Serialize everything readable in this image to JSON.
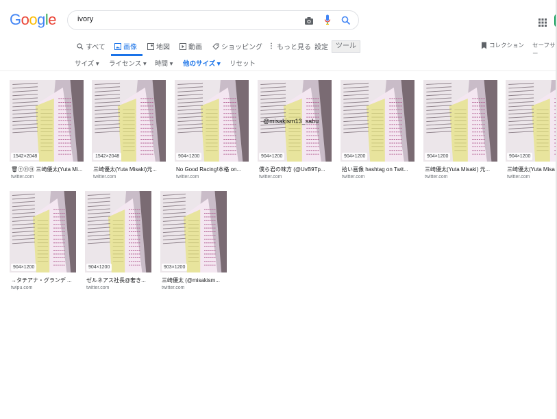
{
  "logo": {
    "g1": "G",
    "o1": "o",
    "o2": "o",
    "g2": "g",
    "l": "l",
    "e": "e"
  },
  "search": {
    "query": "ivory"
  },
  "tabs": [
    {
      "label": "すべて",
      "icon": "search-icon"
    },
    {
      "label": "画像",
      "icon": "image-icon"
    },
    {
      "label": "地図",
      "icon": "map-icon"
    },
    {
      "label": "動画",
      "icon": "video-icon"
    },
    {
      "label": "ショッピング",
      "icon": "tag-icon"
    },
    {
      "label": "もっと見る",
      "icon": "more-icon"
    }
  ],
  "settings_label": "設定",
  "tools_label": "ツール",
  "collections_label": "コレクション",
  "safesearch_label": "セーフサー",
  "filters": [
    {
      "label": "サイズ ▾"
    },
    {
      "label": "ライセンス ▾"
    },
    {
      "label": "時間 ▾"
    },
    {
      "label": "他のサイズ ▾"
    },
    {
      "label": "リセット"
    }
  ],
  "results": [
    {
      "dim": "1542×2048",
      "title": "🗑Ⓣ⑪⑪ 三崎優太(Yuta Mi...",
      "source": "twitter.com"
    },
    {
      "dim": "1542×2048",
      "title": "三崎優太(Yuta Misaki)元...",
      "source": "twitter.com"
    },
    {
      "dim": "904×1200",
      "title": "No Good Racing!本格 on...",
      "source": "twitter.com"
    },
    {
      "dim": "904×1200",
      "title": "僕ら君の味方 (@UvB9Tp...",
      "source": "twitter.com",
      "watermark": "@misakism13_sabu"
    },
    {
      "dim": "904×1200",
      "title": "拾い画像 hashtag on Twit...",
      "source": "twitter.com"
    },
    {
      "dim": "904×1200",
      "title": "三崎優太(Yuta Misaki) 元...",
      "source": "twitter.com"
    },
    {
      "dim": "904×1200",
      "title": "三崎優太(Yuta Misa",
      "source": "twitter.com"
    },
    {
      "dim": "904×1200",
      "title": "→タチアナ・グランデ ...",
      "source": "twipu.com"
    },
    {
      "dim": "904×1200",
      "title": "ゼルネアス社長@奢き...",
      "source": "twitter.com"
    },
    {
      "dim": "903×1200",
      "title": "三崎優太 (@misakism...",
      "source": "twitter.com"
    }
  ]
}
